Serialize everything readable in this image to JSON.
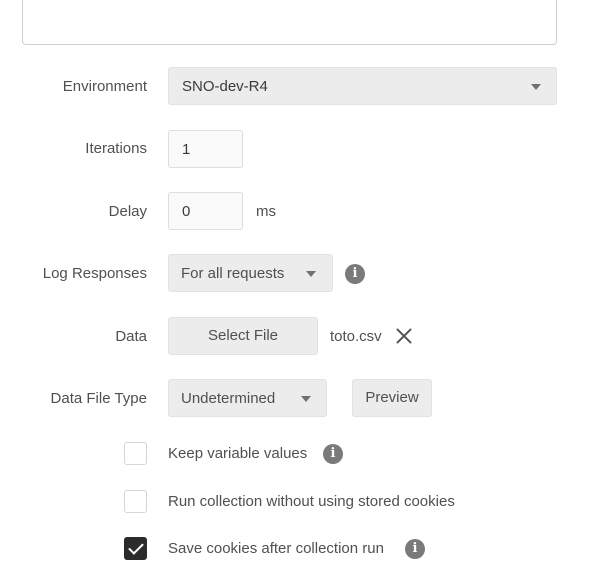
{
  "environment": {
    "label": "Environment",
    "value": "SNO-dev-R4"
  },
  "iterations": {
    "label": "Iterations",
    "value": "1"
  },
  "delay": {
    "label": "Delay",
    "value": "0",
    "unit": "ms"
  },
  "log_responses": {
    "label": "Log Responses",
    "value": "For all requests"
  },
  "data": {
    "label": "Data",
    "select_button": "Select File",
    "file_name": "toto.csv"
  },
  "data_file_type": {
    "label": "Data File Type",
    "value": "Undetermined",
    "preview_button": "Preview"
  },
  "options": [
    {
      "label": "Keep variable values",
      "checked": false,
      "info": true
    },
    {
      "label": "Run collection without using stored cookies",
      "checked": false,
      "info": false
    },
    {
      "label": "Save cookies after collection run",
      "checked": true,
      "info": true
    }
  ],
  "icons": {
    "info": "info-icon",
    "close": "close-icon",
    "dropdown": "chevron-down-icon",
    "check": "check-icon"
  }
}
